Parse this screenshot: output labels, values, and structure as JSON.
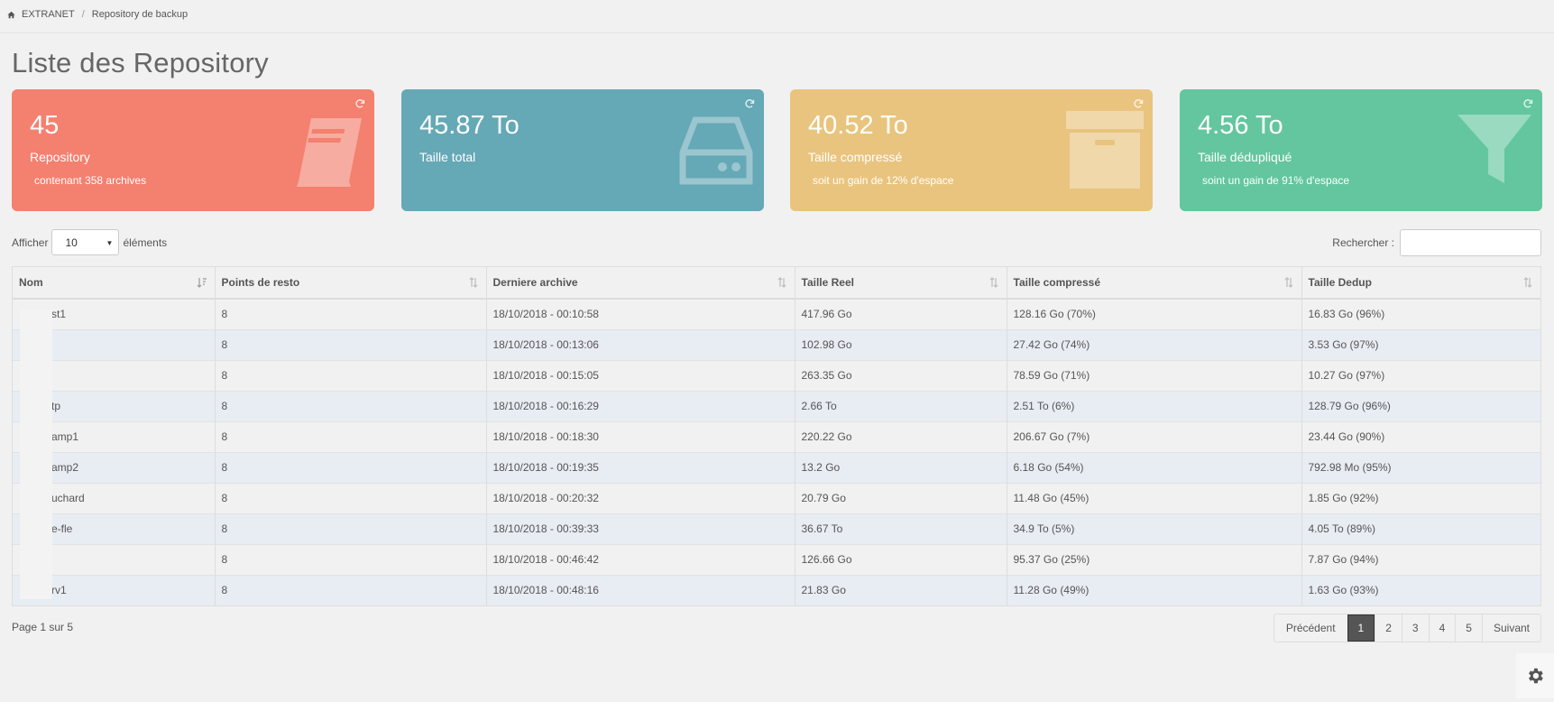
{
  "breadcrumb": {
    "home": "EXTRANET",
    "separator": "/",
    "current": "Repository de backup"
  },
  "page_title": "Liste des Repository",
  "cards": [
    {
      "value": "45",
      "label": "Repository",
      "sub": "contenant 358 archives",
      "icon": "book-icon",
      "color": "#f4806f"
    },
    {
      "value": "45.87 To",
      "label": "Taille total",
      "sub": "",
      "icon": "hdd-icon",
      "color": "#65a8b6"
    },
    {
      "value": "40.52 To",
      "label": "Taille compressé",
      "sub": "soit un gain de 12% d'espace",
      "icon": "archive-icon",
      "color": "#e9c47e"
    },
    {
      "value": "4.56 To",
      "label": "Taille dédupliqué",
      "sub": "soint un gain de 91% d'espace",
      "icon": "filter-icon",
      "color": "#63c69e"
    }
  ],
  "length": {
    "prefix": "Afficher",
    "value": "10",
    "suffix": "éléments"
  },
  "search": {
    "label": "Rechercher :",
    "value": ""
  },
  "table": {
    "columns": [
      "Nom",
      "Points de resto",
      "Derniere archive",
      "Taille Reel",
      "Taille compressé",
      "Taille Dedup"
    ],
    "rows": [
      [
        "st1",
        "8",
        "18/10/2018 - 00:10:58",
        "417.96 Go",
        "128.16 Go (70%)",
        "16.83 Go (96%)"
      ],
      [
        "",
        "8",
        "18/10/2018 - 00:13:06",
        "102.98 Go",
        "27.42 Go (74%)",
        "3.53 Go (97%)"
      ],
      [
        "",
        "8",
        "18/10/2018 - 00:15:05",
        "263.35 Go",
        "78.59 Go (71%)",
        "10.27 Go (97%)"
      ],
      [
        "tp",
        "8",
        "18/10/2018 - 00:16:29",
        "2.66 To",
        "2.51 To (6%)",
        "128.79 Go (96%)"
      ],
      [
        "amp1",
        "8",
        "18/10/2018 - 00:18:30",
        "220.22 Go",
        "206.67 Go (7%)",
        "23.44 Go (90%)"
      ],
      [
        "amp2",
        "8",
        "18/10/2018 - 00:19:35",
        "13.2 Go",
        "6.18 Go (54%)",
        "792.98 Mo (95%)"
      ],
      [
        "uchard",
        "8",
        "18/10/2018 - 00:20:32",
        "20.79 Go",
        "11.48 Go (45%)",
        "1.85 Go (92%)"
      ],
      [
        "e-fle",
        "8",
        "18/10/2018 - 00:39:33",
        "36.67 To",
        "34.9 To (5%)",
        "4.05 To (89%)"
      ],
      [
        "",
        "8",
        "18/10/2018 - 00:46:42",
        "126.66 Go",
        "95.37 Go (25%)",
        "7.87 Go (94%)"
      ],
      [
        "rv1",
        "8",
        "18/10/2018 - 00:48:16",
        "21.83 Go",
        "11.28 Go (49%)",
        "1.63 Go (93%)"
      ]
    ]
  },
  "page_info": "Page 1 sur 5",
  "pagination": {
    "prev": "Précédent",
    "pages": [
      "1",
      "2",
      "3",
      "4",
      "5"
    ],
    "active": "1",
    "next": "Suivant"
  }
}
